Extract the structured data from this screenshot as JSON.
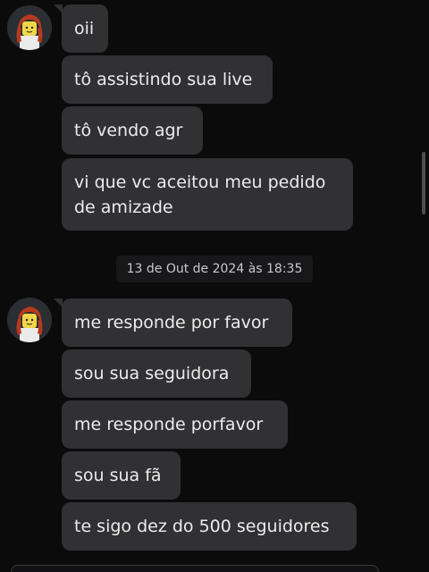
{
  "messages_group_1": [
    {
      "text": "oii"
    },
    {
      "text": "tô assistindo sua live"
    },
    {
      "text": "tô vendo agr"
    },
    {
      "text": "vi que vc aceitou meu pedido de amizade"
    }
  ],
  "timestamp": "13 de Out de 2024 às 18:35",
  "messages_group_2": [
    {
      "text": "me responde por favor"
    },
    {
      "text": "sou sua seguidora"
    },
    {
      "text": "me responde porfavor"
    },
    {
      "text": "sou sua fã"
    },
    {
      "text": "te sigo dez do 500 seguidores"
    }
  ],
  "colors": {
    "background": "#0b0b0c",
    "bubble": "#313134",
    "text": "#ececec",
    "timestamp_bg": "#18181a"
  }
}
